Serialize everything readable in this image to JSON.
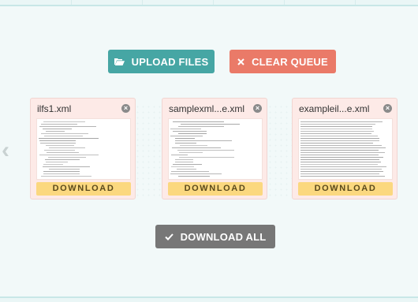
{
  "toolbar": {
    "upload_label": "UPLOAD FILES",
    "clear_label": "CLEAR QUEUE",
    "download_all_label": "DOWNLOAD ALL"
  },
  "carousel": {
    "prev_icon": "chevron-left-icon"
  },
  "files": [
    {
      "name": "ilfs1.xml",
      "download_label": "DOWNLOAD"
    },
    {
      "name": "samplexml...e.xml",
      "download_label": "DOWNLOAD"
    },
    {
      "name": "exampleil...e.xml",
      "download_label": "DOWNLOAD"
    }
  ],
  "colors": {
    "upload": "#46a6a4",
    "clear": "#ea7a68",
    "download_all": "#777777",
    "card_bg": "#fdeae7",
    "download_btn": "#fbd87f"
  }
}
